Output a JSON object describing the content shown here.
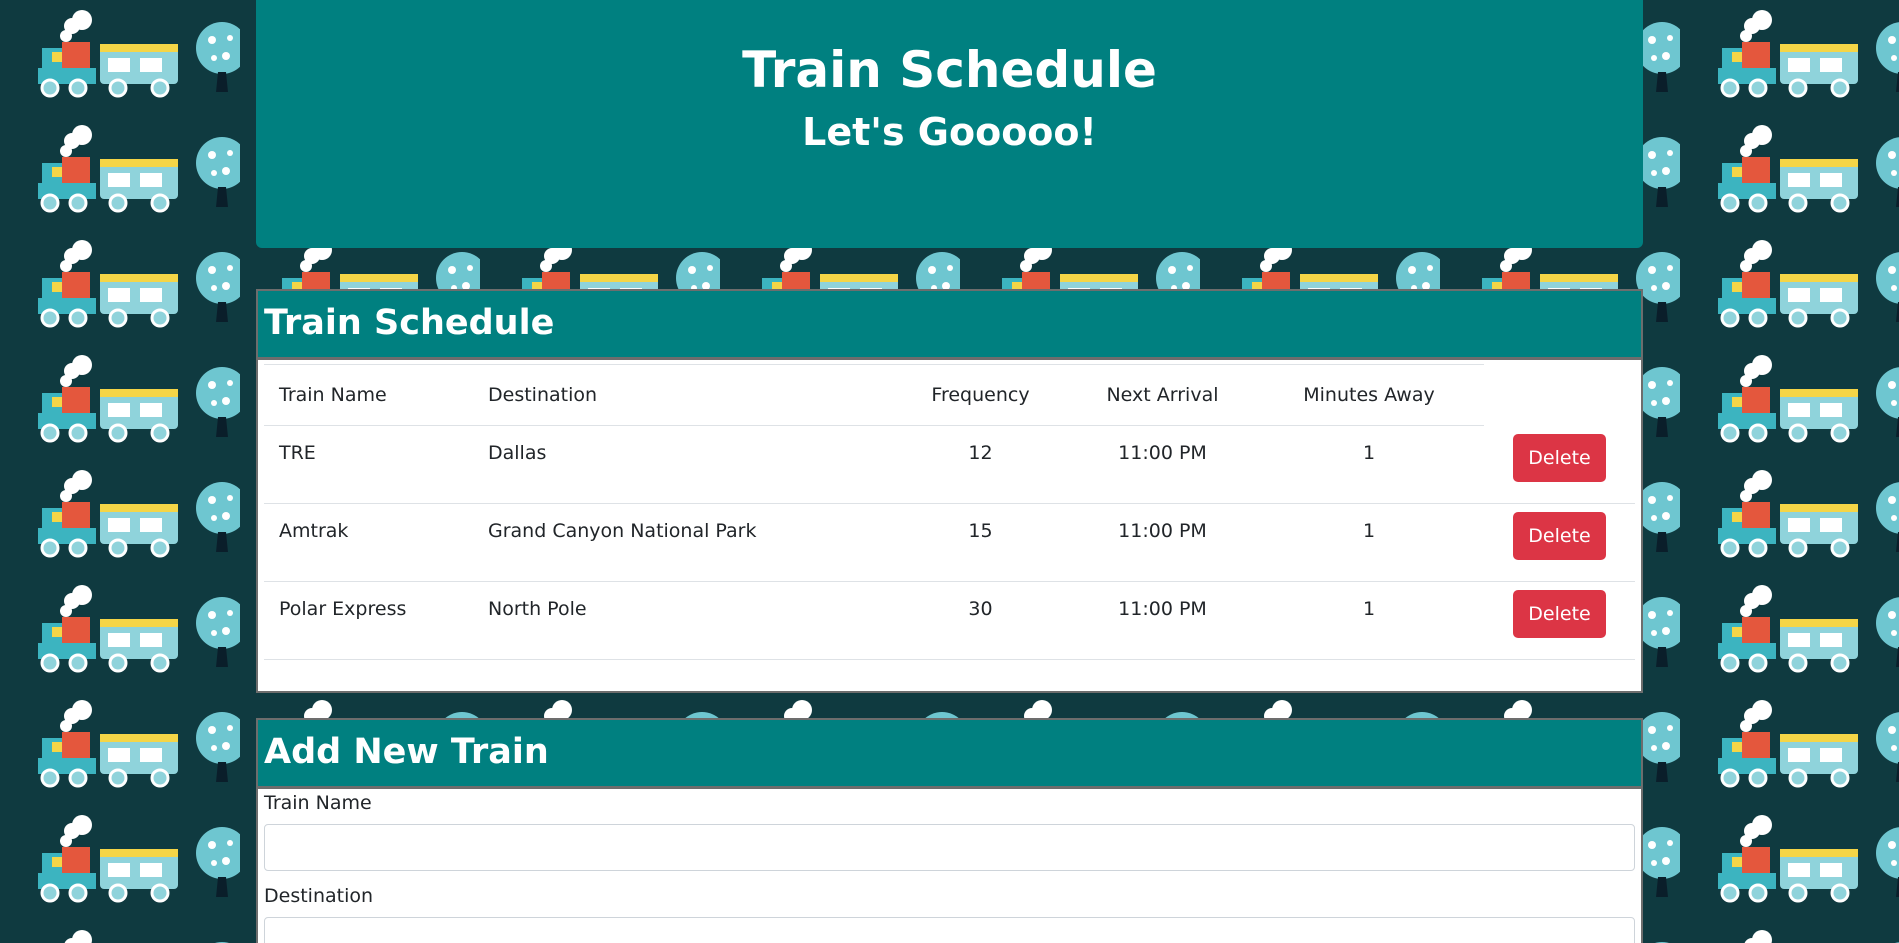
{
  "header": {
    "title": "Train Schedule",
    "subtitle": "Let's Gooooo!"
  },
  "schedule": {
    "title": "Train Schedule",
    "columns": [
      "Train Name",
      "Destination",
      "Frequency",
      "Next Arrival",
      "Minutes Away"
    ],
    "rows": [
      {
        "name": "TRE",
        "destination": "Dallas",
        "frequency": "12",
        "next_arrival": "11:00 PM",
        "minutes_away": "1",
        "delete_label": "Delete"
      },
      {
        "name": "Amtrak",
        "destination": "Grand Canyon National Park",
        "frequency": "15",
        "next_arrival": "11:00 PM",
        "minutes_away": "1",
        "delete_label": "Delete"
      },
      {
        "name": "Polar Express",
        "destination": "North Pole",
        "frequency": "30",
        "next_arrival": "11:00 PM",
        "minutes_away": "1",
        "delete_label": "Delete"
      }
    ]
  },
  "add_train": {
    "title": "Add New Train",
    "train_name_label": "Train Name",
    "train_name_value": "",
    "destination_label": "Destination",
    "destination_value": ""
  },
  "colors": {
    "header_bg": "#008080",
    "page_bg": "#0f3a40",
    "delete_button": "#dc3545"
  },
  "background_pattern": "train-and-tree-pattern"
}
